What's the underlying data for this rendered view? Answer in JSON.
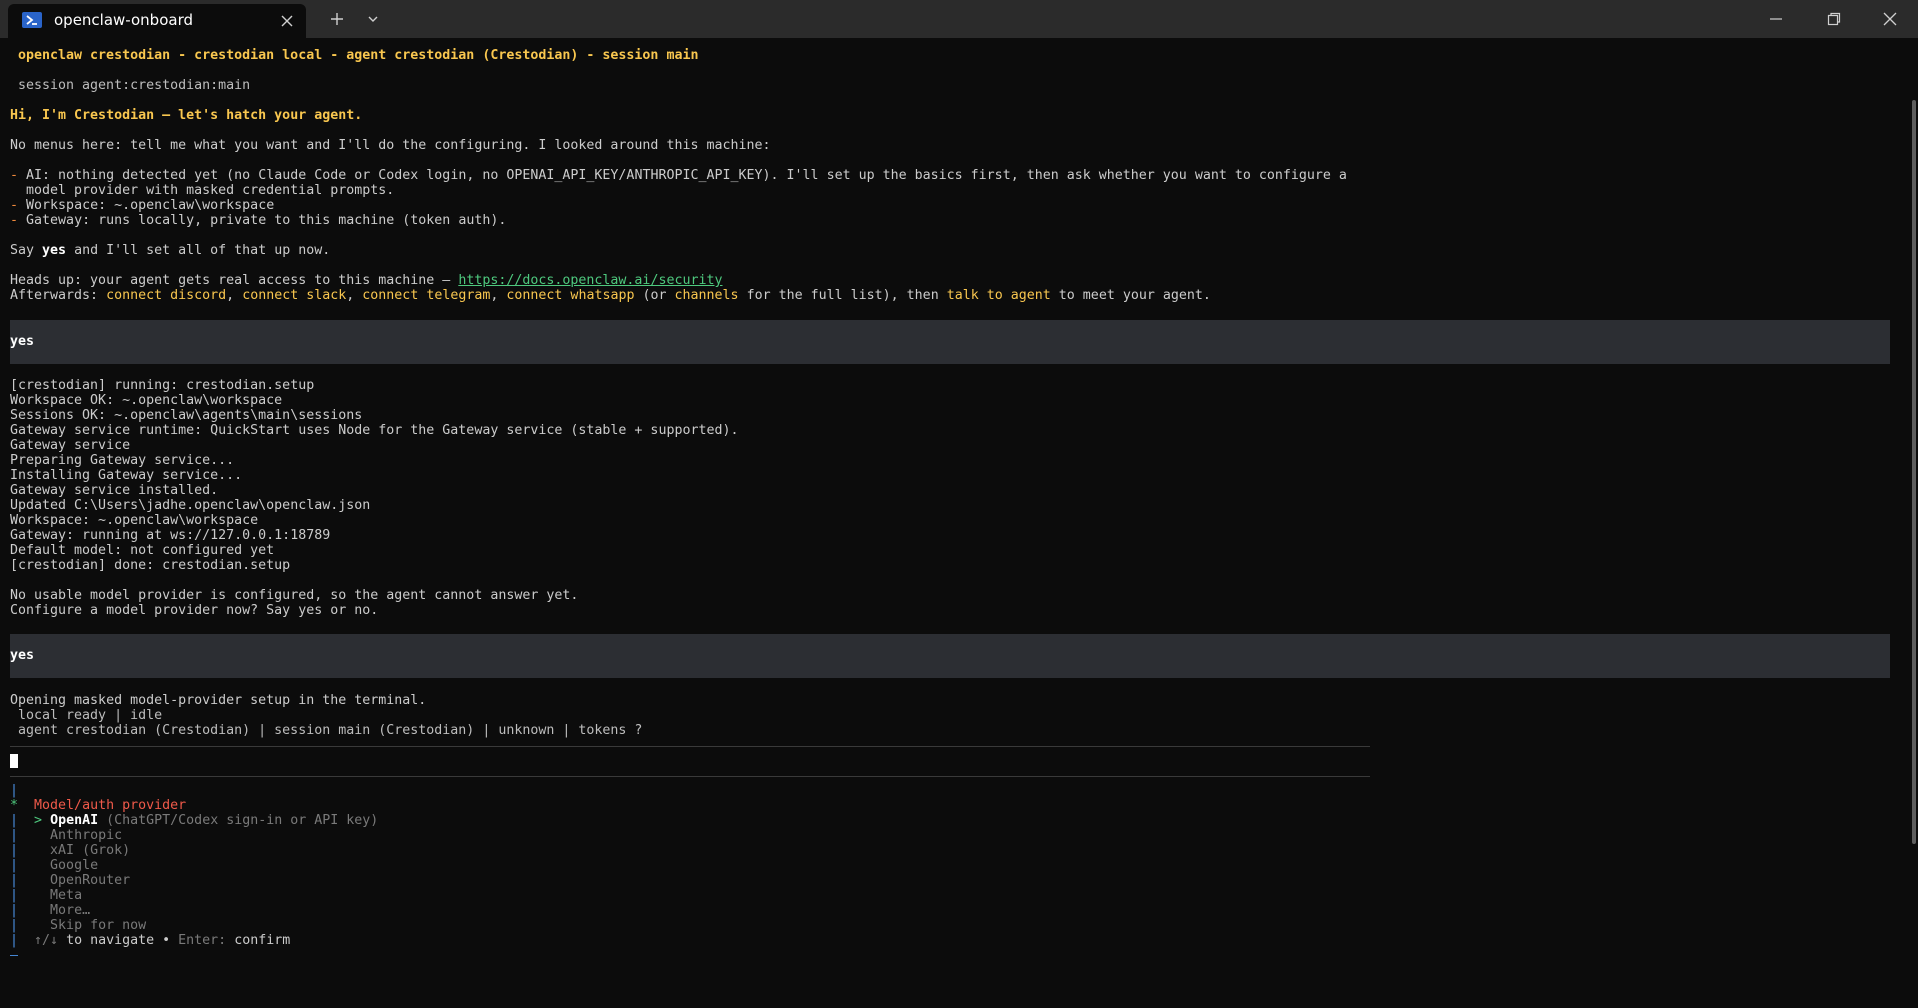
{
  "window": {
    "tab_title": "openclaw-onboard",
    "new_tab_label": "+",
    "icons": [
      "powershell-icon",
      "close-icon",
      "plus-icon",
      "chevron-down-icon",
      "minimize-icon",
      "maximize-icon",
      "close-icon"
    ]
  },
  "header": {
    "status_line": "openclaw crestodian - crestodian local - agent crestodian (Crestodian) - session main",
    "session_line": "session agent:crestodian:main"
  },
  "intro": {
    "greeting": "Hi, I'm Crestodian — let's hatch your agent.",
    "menus_line": "No menus here: tell me what you want and I'll do the configuring. I looked around this machine:",
    "bullet_marker": "-",
    "bullet1_a": "AI: nothing detected yet (no Claude Code or Codex login, no OPENAI_API_KEY/ANTHROPIC_API_KEY). I'll set up the basics first, then ask whether you want to configure a",
    "bullet1_b": "model provider with masked credential prompts.",
    "bullet2": "Workspace: ~.openclaw\\workspace",
    "bullet3": "Gateway: runs locally, private to this machine (token auth).",
    "say_pre": "Say ",
    "say_yes": "yes",
    "say_post": " and I'll set all of that up now.",
    "headsup_pre": "Heads up: your agent gets real access to this machine — ",
    "headsup_link": "https://docs.openclaw.ai/security",
    "after_pre": "Afterwards: ",
    "after_c1": "connect discord",
    "after_sep1": ", ",
    "after_c2": "connect slack",
    "after_sep2": ", ",
    "after_c3": "connect telegram",
    "after_sep3": ", ",
    "after_c4": "connect whatsapp",
    "after_mid": " (or ",
    "after_c5": "channels",
    "after_mid2": " for the full list), then ",
    "after_c6": "talk to agent",
    "after_end": " to meet your agent."
  },
  "user_input_1": "yes",
  "setup_log": [
    "[crestodian] running: crestodian.setup",
    "Workspace OK: ~.openclaw\\workspace",
    "Sessions OK: ~.openclaw\\agents\\main\\sessions",
    "Gateway service runtime: QuickStart uses Node for the Gateway service (stable + supported).",
    "Gateway service",
    "Preparing Gateway service...",
    "Installing Gateway service...",
    "Gateway service installed.",
    "Updated C:\\Users\\jadhe.openclaw\\openclaw.json",
    "Workspace: ~.openclaw\\workspace",
    "Gateway: running at ws://127.0.0.1:18789",
    "Default model: not configured yet",
    "[crestodian] done: crestodian.setup"
  ],
  "provider_prompt": [
    "No usable model provider is configured, so the agent cannot answer yet.",
    "Configure a model provider now? Say yes or no."
  ],
  "user_input_2": "yes",
  "status": {
    "opening": "Opening masked model-provider setup in the terminal.",
    "ready": "local ready | idle",
    "footer": "agent crestodian (Crestodian) | session main (Crestodian) | unknown | tokens ?"
  },
  "picker": {
    "rail_char": "|",
    "active_marker": "*",
    "end_marker": "—",
    "title": "Model/auth provider",
    "pointer": ">",
    "selected_label": "OpenAI",
    "selected_hint": "(ChatGPT/Codex sign-in or API key)",
    "options": [
      "Anthropic",
      "xAI (Grok)",
      "Google",
      "OpenRouter",
      "Meta",
      "More…",
      "Skip for now"
    ],
    "nav_arrows": "↑/↓",
    "nav_text": " to navigate • ",
    "enter_label": "Enter:",
    "confirm_label": " confirm"
  }
}
